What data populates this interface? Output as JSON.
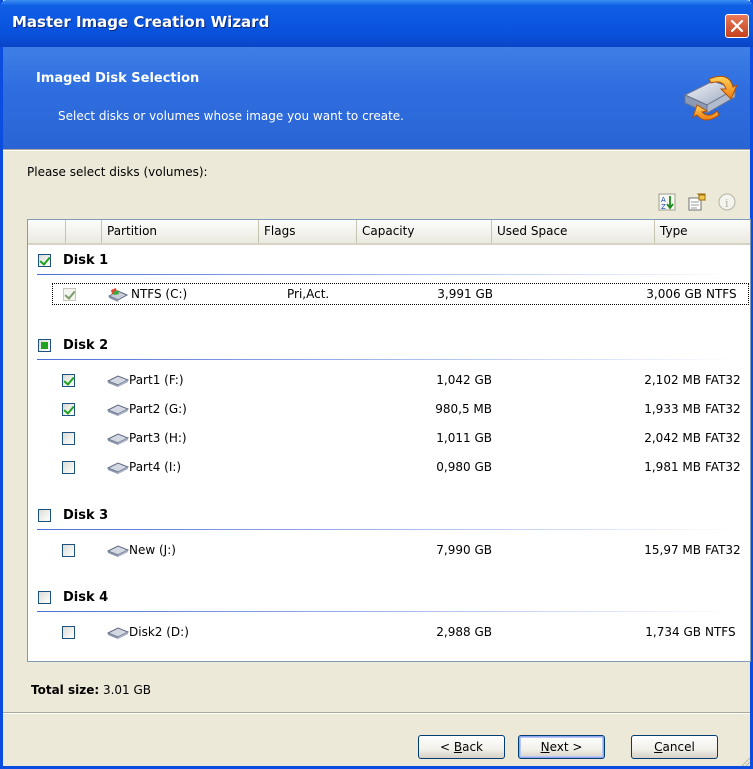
{
  "window": {
    "title": "Master Image Creation Wizard",
    "close_icon": "close-icon",
    "accent": "#0a4de0",
    "banner_color": "#2f6ee0"
  },
  "banner": {
    "title": "Imaged Disk Selection",
    "subtitle": "Select disks or volumes whose image you want to create.",
    "icon": "disk-arrow-icon"
  },
  "prompt": "Please select disks (volumes):",
  "toolbar": {
    "icons": [
      "sort-icon",
      "properties-icon",
      "info-icon"
    ]
  },
  "columns": [
    "Partition",
    "Flags",
    "Capacity",
    "Used Space",
    "Type"
  ],
  "disks": [
    {
      "label": "Disk 1",
      "state": "checked",
      "partitions": [
        {
          "name": "NTFS (C:)",
          "flags": "Pri,Act.",
          "capacity": "3,991 GB",
          "used": "3,006 GB",
          "type": "NTFS",
          "checked": true,
          "disabled": true,
          "selected": true,
          "icon": "system-disk-icon"
        }
      ]
    },
    {
      "label": "Disk 2",
      "state": "partial",
      "partitions": [
        {
          "name": "Part1 (F:)",
          "flags": "",
          "capacity": "1,042 GB",
          "used": "2,102 MB",
          "type": "FAT32",
          "checked": true,
          "icon": "disk-icon"
        },
        {
          "name": "Part2 (G:)",
          "flags": "",
          "capacity": "980,5 MB",
          "used": "1,933 MB",
          "type": "FAT32",
          "checked": true,
          "icon": "disk-icon"
        },
        {
          "name": "Part3 (H:)",
          "flags": "",
          "capacity": "1,011 GB",
          "used": "2,042 MB",
          "type": "FAT32",
          "checked": false,
          "icon": "disk-icon"
        },
        {
          "name": "Part4 (I:)",
          "flags": "",
          "capacity": "0,980 GB",
          "used": "1,981 MB",
          "type": "FAT32",
          "checked": false,
          "icon": "disk-icon"
        }
      ]
    },
    {
      "label": "Disk 3",
      "state": "unchecked",
      "partitions": [
        {
          "name": "New (J:)",
          "flags": "",
          "capacity": "7,990 GB",
          "used": "15,97 MB",
          "type": "FAT32",
          "checked": false,
          "icon": "disk-icon"
        }
      ]
    },
    {
      "label": "Disk 4",
      "state": "unchecked",
      "partitions": [
        {
          "name": "Disk2 (D:)",
          "flags": "",
          "capacity": "2,988 GB",
          "used": "1,734 GB",
          "type": "NTFS",
          "checked": false,
          "icon": "disk-icon"
        }
      ]
    }
  ],
  "total": {
    "label": "Total size:",
    "value": "3.01 GB"
  },
  "buttons": {
    "back": {
      "prefix": "< ",
      "mnemonic": "B",
      "rest": "ack"
    },
    "next": {
      "mnemonic": "N",
      "rest": "ext >"
    },
    "cancel": {
      "mnemonic": "C",
      "rest": "ancel"
    }
  }
}
